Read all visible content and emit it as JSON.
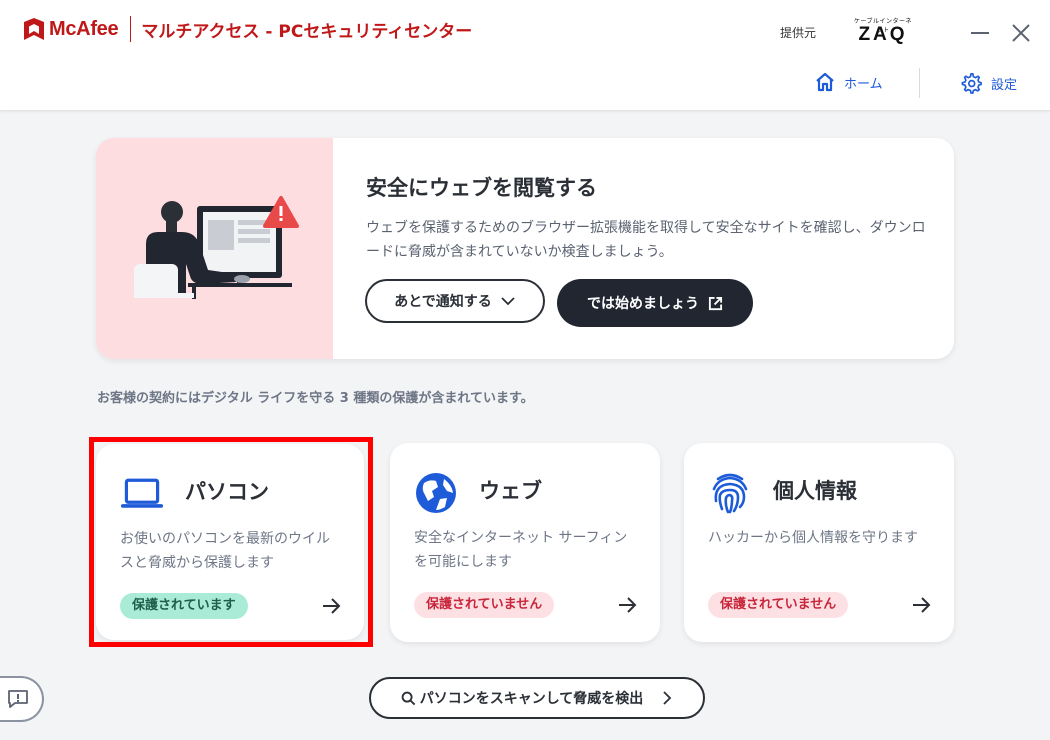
{
  "header": {
    "brand_name": "McAfee",
    "product_name": "マルチアクセス - PCセキュリティセンター",
    "provider_label": "提供元",
    "provider_logo_small": "ケーブルインターネット",
    "provider_logo_big": "ZAQ",
    "nav": {
      "home_label": "ホーム",
      "settings_label": "設定"
    }
  },
  "promo": {
    "title": "安全にウェブを閲覧する",
    "description": "ウェブを保護するためのブラウザー拡張機能を取得して安全なサイトを確認し、ダウンロードに脅威が含まれていないか検査しましょう。",
    "later_button": "あとで通知する",
    "start_button": "では始めましょう"
  },
  "subscription_note": "お客様の契約にはデジタル ライフを守る 3 種類の保護が含まれています。",
  "cards": [
    {
      "title": "パソコン",
      "description": "お使いのパソコンを最新のウイルスと脅威から保護します",
      "status": "保護されています",
      "status_ok": true
    },
    {
      "title": "ウェブ",
      "description": "安全なインターネット サーフィンを可能にします",
      "status": "保護されていません",
      "status_ok": false
    },
    {
      "title": "個人情報",
      "description": "ハッカーから個人情報を守ります",
      "status": "保護されていません",
      "status_ok": false
    }
  ],
  "scan_button": "パソコンをスキャンして脅威を検出",
  "colors": {
    "brand_red": "#c01818",
    "accent_blue": "#1d5bd8",
    "ok_badge_bg": "#a9ebd6",
    "ng_badge_bg": "#fde0e3",
    "highlight_red": "#ff0000"
  },
  "icons": [
    "mcafee-shield-icon",
    "minimize-icon",
    "close-icon",
    "home-icon",
    "gear-icon",
    "chevron-down-icon",
    "external-link-icon",
    "laptop-icon",
    "globe-icon",
    "fingerprint-icon",
    "arrow-right-icon",
    "feedback-icon",
    "search-icon",
    "chevron-right-icon"
  ]
}
